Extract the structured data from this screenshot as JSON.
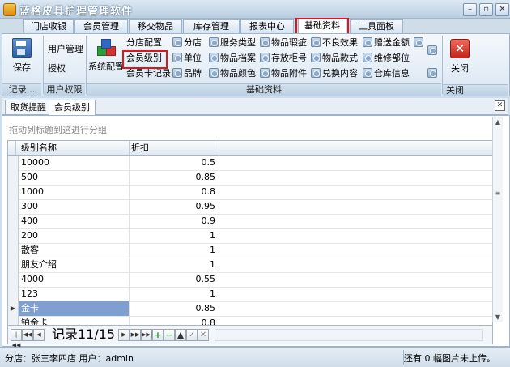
{
  "app": {
    "title": "蓝格皮具护理管理软件"
  },
  "ribbon_tabs": [
    "门店收银",
    "会员管理",
    "移交物品",
    "库存管理",
    "报表中心",
    "基础资料",
    "工具面板"
  ],
  "active_tab": "基础资料",
  "ribbon": {
    "group_record": {
      "save_label": "保存",
      "group_label": "记录..."
    },
    "group_perm": {
      "user_mgmt": "用户管理",
      "auth": "授权",
      "group_label": "用户权限"
    },
    "group_base": {
      "sys_config": "系统配置",
      "group_label": "基础资料",
      "col1": [
        "分店配置",
        "会员级别",
        "会员卡记录"
      ],
      "col2": [
        "分店",
        "单位",
        "品牌"
      ],
      "col3": [
        "服务类型",
        "物品档案",
        "物品颜色"
      ],
      "col4": [
        "物品瑕疵",
        "存放柜号",
        "物品附件"
      ],
      "col5": [
        "不良效果",
        "物品款式",
        "兑换内容"
      ],
      "col6": [
        "赠送金额",
        "维修部位",
        "仓库信息"
      ]
    },
    "group_close": {
      "close_label": "关闭",
      "group_label": "关闭"
    }
  },
  "doc_tabs": [
    "取货提醒",
    "会员级别"
  ],
  "active_doc_tab": "会员级别",
  "grid": {
    "group_hint": "拖动列标题到这进行分组",
    "columns": [
      "级别名称",
      "折扣"
    ],
    "rows": [
      {
        "name": "10000",
        "discount": "0.5"
      },
      {
        "name": "500",
        "discount": "0.85"
      },
      {
        "name": "1000",
        "discount": "0.8"
      },
      {
        "name": "300",
        "discount": "0.95"
      },
      {
        "name": "400",
        "discount": "0.9"
      },
      {
        "name": "200",
        "discount": "1"
      },
      {
        "name": "散客",
        "discount": "1"
      },
      {
        "name": "朋友介绍",
        "discount": "1"
      },
      {
        "name": "4000",
        "discount": "0.55"
      },
      {
        "name": "123",
        "discount": "1"
      },
      {
        "name": "金卡",
        "discount": "0.85"
      },
      {
        "name": "铂金卡",
        "discount": "0.8"
      }
    ],
    "selected_row": 10
  },
  "navigator": {
    "record_text": "记录11/15"
  },
  "status": {
    "left": "分店：张三李四店  用户：admin",
    "right": "还有 0 幅图片未上传。"
  },
  "colors": {
    "highlight_box": "#e0141b",
    "selected_row": "#7e9fcf"
  }
}
